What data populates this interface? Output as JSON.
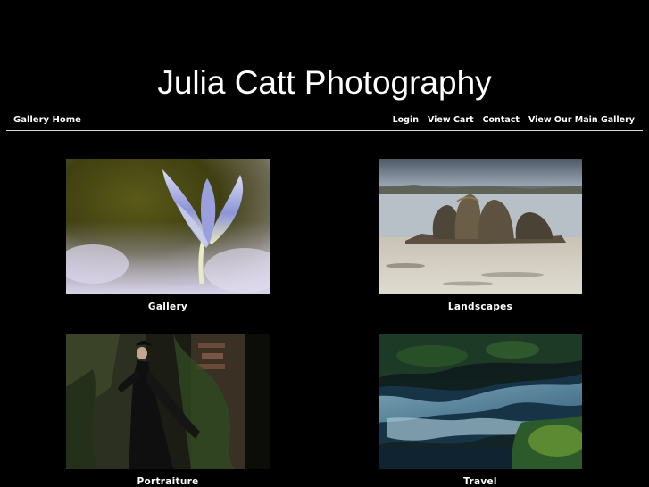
{
  "header": {
    "title": "Julia Catt Photography"
  },
  "nav": {
    "home": "Gallery Home",
    "links": [
      "Login",
      "View Cart",
      "Contact",
      "View Our Main Gallery"
    ]
  },
  "galleries": [
    {
      "label": "Gallery",
      "image": "crocus-flower-photo"
    },
    {
      "label": "Landscapes",
      "image": "coastal-rocks-photo"
    },
    {
      "label": "Portraiture",
      "image": "woman-in-black-gown-photo"
    },
    {
      "label": "Travel",
      "image": "forest-waterfall-photo"
    }
  ]
}
